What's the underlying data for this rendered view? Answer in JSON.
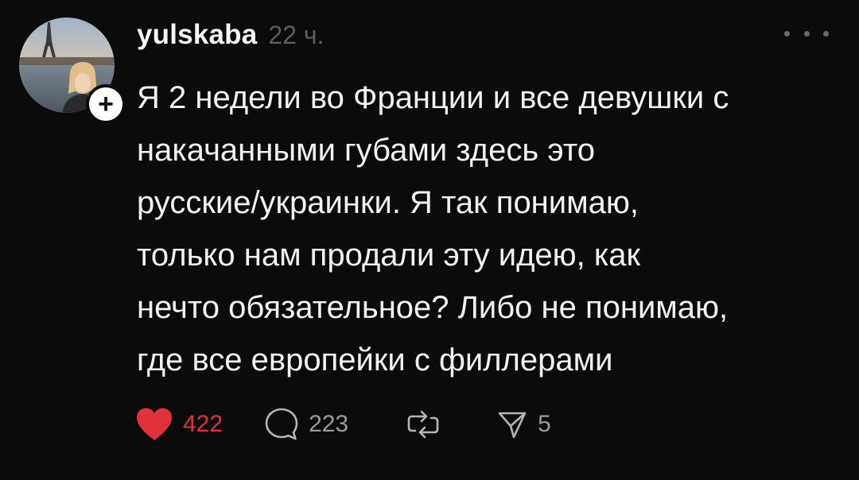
{
  "post": {
    "username": "yulskaba",
    "timestamp": "22 ч.",
    "text": "Я 2 недели во Франции и все девушки с\nнакачанными губами здесь это\nрусские/украинки. Я так понимаю,\nтолько нам продали эту идею, как\nнечто обязательное? Либо не понимаю,\nгде все европейки с филлерами",
    "follow_icon": "plus-icon",
    "more_icon": "more-dots-icon"
  },
  "actions": {
    "likes": "422",
    "replies": "223",
    "shares": "5",
    "liked": true
  },
  "colors": {
    "background": "#0b0b0b",
    "text": "#f2f2f2",
    "muted": "#5d5d5d",
    "like_active": "#e0313c"
  }
}
